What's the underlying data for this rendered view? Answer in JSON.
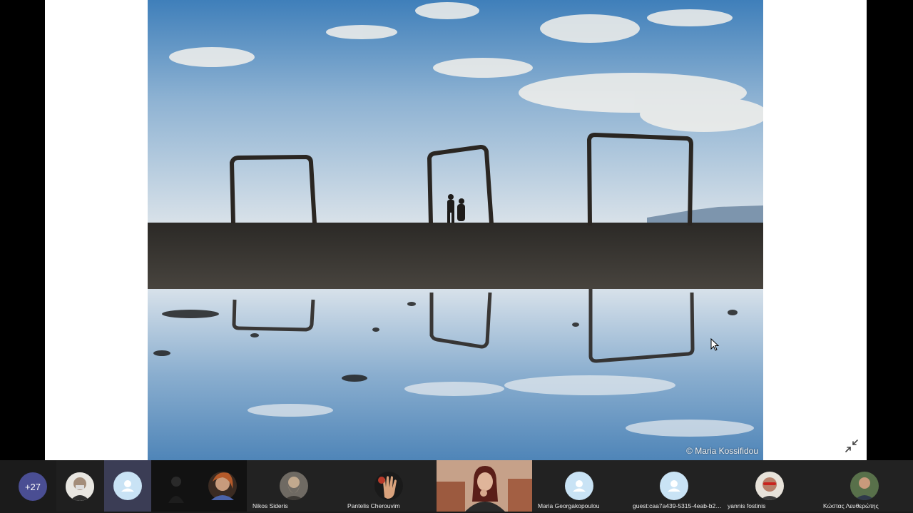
{
  "slide": {
    "photo_credit": "© Maria Kossifidou"
  },
  "controls": {
    "collapse_icon": "collapse-arrows-icon",
    "more_participants": "+27"
  },
  "participants": [
    {
      "name": "",
      "avatar": "photo"
    },
    {
      "name": "",
      "avatar": "generic-person-icon"
    },
    {
      "name": "",
      "avatar": "photo"
    },
    {
      "name": "Nikos Sideris",
      "avatar": "photo"
    },
    {
      "name": "Pantelis Cherouvim",
      "avatar": "photo"
    },
    {
      "name": "",
      "avatar": "video"
    },
    {
      "name": "Maria Georgakopoulou",
      "avatar": "generic-person-icon"
    },
    {
      "name": "guest:caa7a439-5315-4eab-b26d-2...",
      "avatar": "generic-person-icon"
    },
    {
      "name": "yannis fostinis",
      "avatar": "photo"
    },
    {
      "name": "Κώστας Λευθερώτης",
      "avatar": "photo"
    }
  ],
  "colors": {
    "strip_background": "#1b1b1b",
    "more_badge": "#4a4e93",
    "generic_avatar": "#c9e3f5"
  }
}
